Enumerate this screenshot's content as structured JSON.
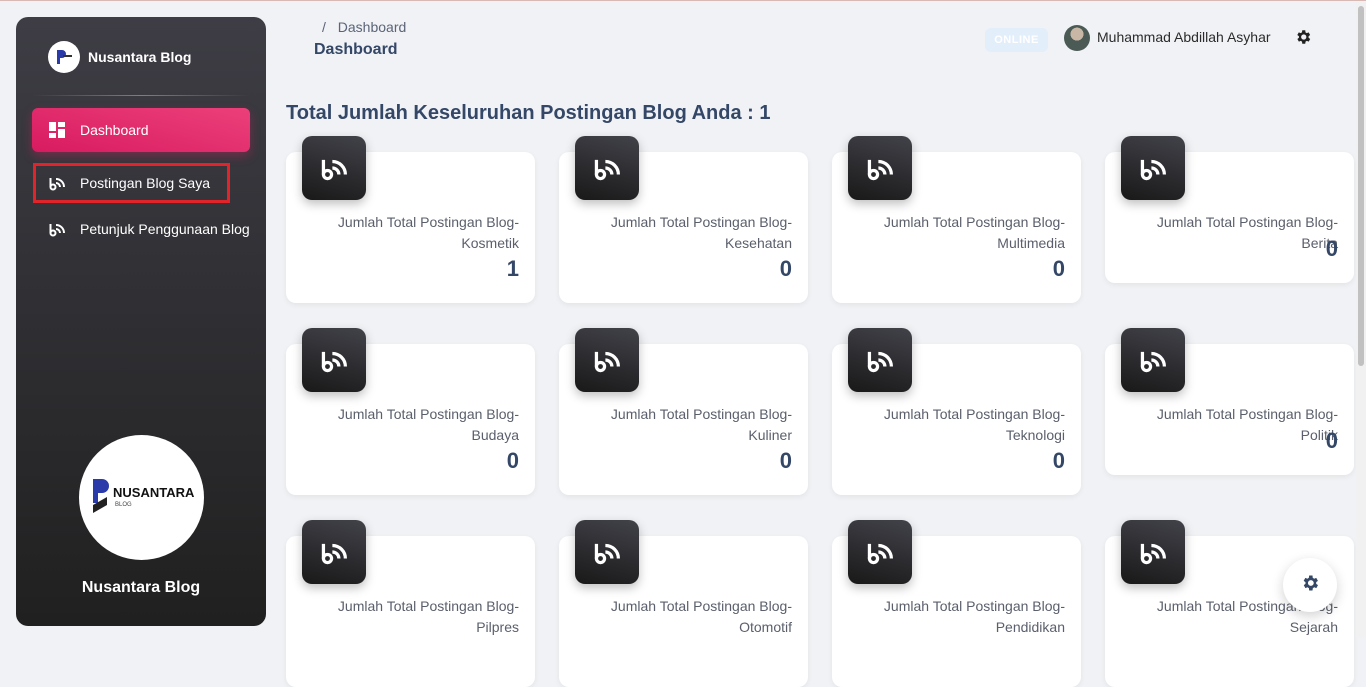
{
  "brand": {
    "name": "Nusantara Blog"
  },
  "sidebar": {
    "items": [
      {
        "label": "Dashboard",
        "icon": "dashboard-icon",
        "active": true
      },
      {
        "label": "Postingan Blog Saya",
        "icon": "blog-icon",
        "active": false
      },
      {
        "label": "Petunjuk Penggunaan Blog",
        "icon": "blog-icon",
        "active": false
      }
    ],
    "logo_text": "NUSANTARA",
    "logo_subtext": "BLOG",
    "footer_name": "Nusantara Blog"
  },
  "header": {
    "breadcrumb": "Dashboard",
    "breadcrumb_sep": "/",
    "title": "Dashboard",
    "status": "ONLINE",
    "user_name": "Muhammad Abdillah Asyhar"
  },
  "main": {
    "title": "Total Jumlah Keseluruhan Postingan Blog Anda : 1",
    "cards": [
      {
        "label": "Jumlah Total Postingan Blog-Kosmetik",
        "value": "1"
      },
      {
        "label": "Jumlah Total Postingan Blog-Kesehatan",
        "value": "0"
      },
      {
        "label": "Jumlah Total Postingan Blog-Multimedia",
        "value": "0"
      },
      {
        "label": "Jumlah Total Postingan Blog-Berita",
        "value": "0"
      },
      {
        "label": "Jumlah Total Postingan Blog-Budaya",
        "value": "0"
      },
      {
        "label": "Jumlah Total Postingan Blog-Kuliner",
        "value": "0"
      },
      {
        "label": "Jumlah Total Postingan Blog-Teknologi",
        "value": "0"
      },
      {
        "label": "Jumlah Total Postingan Blog-Politik",
        "value": "0"
      },
      {
        "label": "Jumlah Total Postingan Blog-Pilpres",
        "value": ""
      },
      {
        "label": "Jumlah Total Postingan Blog-Otomotif",
        "value": ""
      },
      {
        "label": "Jumlah Total Postingan Blog-Pendidikan",
        "value": ""
      },
      {
        "label": "Jumlah Total Postingan Blog-Sejarah",
        "value": ""
      }
    ]
  },
  "colors": {
    "accent": "#e91e63",
    "sidebar_dark": "#202020",
    "highlight": "#e0242a"
  }
}
